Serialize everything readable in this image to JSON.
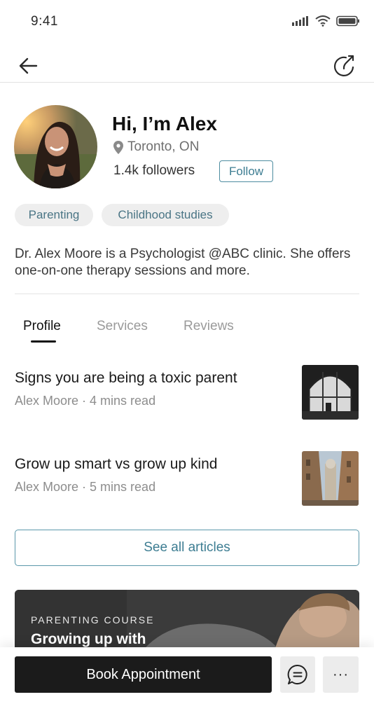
{
  "status_bar": {
    "time": "9:41",
    "icons": [
      "signal-icon",
      "wifi-icon",
      "battery-icon"
    ]
  },
  "nav": {
    "back_icon": "arrow-left-icon",
    "share_icon": "share-icon"
  },
  "profile": {
    "name": "Hi, I’m Alex",
    "location": "Toronto, ON",
    "location_icon": "location-pin-icon",
    "followers": "1.4k followers",
    "follow_label": "Follow",
    "tags": [
      "Parenting",
      "Childhood studies"
    ],
    "bio": "Dr. Alex Moore is a Psychologist @ABC clinic. She offers one-on-one therapy sessions and more."
  },
  "tabs": [
    {
      "label": "Profile",
      "active": true
    },
    {
      "label": "Services",
      "active": false
    },
    {
      "label": "Reviews",
      "active": false
    }
  ],
  "articles": [
    {
      "title": "Signs you are being a toxic parent",
      "meta": "Alex Moore · 4 mins read"
    },
    {
      "title": "Grow up smart vs grow up kind",
      "meta": "Alex Moore · 5 mins read"
    }
  ],
  "see_all_label": "See all articles",
  "course": {
    "kicker": "PARENTING COURSE",
    "title": "Growing up with"
  },
  "bottom_bar": {
    "book_label": "Book Appointment",
    "chat_icon": "chat-bubble-icon",
    "more_label": "···"
  },
  "colors": {
    "accent": "#3d7d92",
    "tag_bg": "#eeeeee",
    "primary_button": "#1b1b1b"
  }
}
